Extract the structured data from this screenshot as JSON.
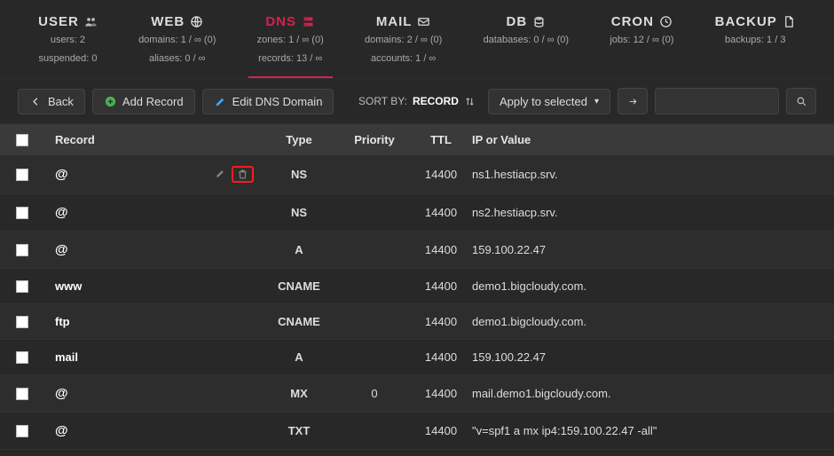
{
  "topnav": [
    {
      "key": "user",
      "title": "USER",
      "icon": "users",
      "line1": "users: 2",
      "line2": "suspended: 0"
    },
    {
      "key": "web",
      "title": "WEB",
      "icon": "globe",
      "line1": "domains: 1 / ∞ (0)",
      "line2": "aliases: 0 / ∞"
    },
    {
      "key": "dns",
      "title": "DNS",
      "icon": "dns",
      "line1": "zones: 1 / ∞ (0)",
      "line2": "records: 13 / ∞",
      "active": true
    },
    {
      "key": "mail",
      "title": "MAIL",
      "icon": "mail",
      "line1": "domains: 2 / ∞ (0)",
      "line2": "accounts: 1 / ∞"
    },
    {
      "key": "db",
      "title": "DB",
      "icon": "db",
      "line1": "databases: 0 / ∞ (0)",
      "line2": ""
    },
    {
      "key": "cron",
      "title": "CRON",
      "icon": "clock",
      "line1": "jobs: 12 / ∞ (0)",
      "line2": ""
    },
    {
      "key": "backup",
      "title": "BACKUP",
      "icon": "file",
      "line1": "backups: 1 / 3",
      "line2": ""
    }
  ],
  "toolbar": {
    "back_label": "Back",
    "add_label": "Add Record",
    "edit_label": "Edit DNS Domain",
    "sort_label": "SORT BY:",
    "sort_field": "RECORD",
    "apply_label": "Apply to selected"
  },
  "headers": {
    "record": "Record",
    "type": "Type",
    "priority": "Priority",
    "ttl": "TTL",
    "value": "IP or Value"
  },
  "rows": [
    {
      "record": "@",
      "type": "NS",
      "priority": "",
      "ttl": "14400",
      "value": "ns1.hestiacp.srv.",
      "row_actions": true,
      "highlight_delete": true
    },
    {
      "record": "@",
      "type": "NS",
      "priority": "",
      "ttl": "14400",
      "value": "ns2.hestiacp.srv."
    },
    {
      "record": "@",
      "type": "A",
      "priority": "",
      "ttl": "14400",
      "value": "159.100.22.47"
    },
    {
      "record": "www",
      "type": "CNAME",
      "priority": "",
      "ttl": "14400",
      "value": "demo1.bigcloudy.com."
    },
    {
      "record": "ftp",
      "type": "CNAME",
      "priority": "",
      "ttl": "14400",
      "value": "demo1.bigcloudy.com."
    },
    {
      "record": "mail",
      "type": "A",
      "priority": "",
      "ttl": "14400",
      "value": "159.100.22.47"
    },
    {
      "record": "@",
      "type": "MX",
      "priority": "0",
      "ttl": "14400",
      "value": "mail.demo1.bigcloudy.com."
    },
    {
      "record": "@",
      "type": "TXT",
      "priority": "",
      "ttl": "14400",
      "value": "\"v=spf1 a mx ip4:159.100.22.47 -all\""
    }
  ]
}
